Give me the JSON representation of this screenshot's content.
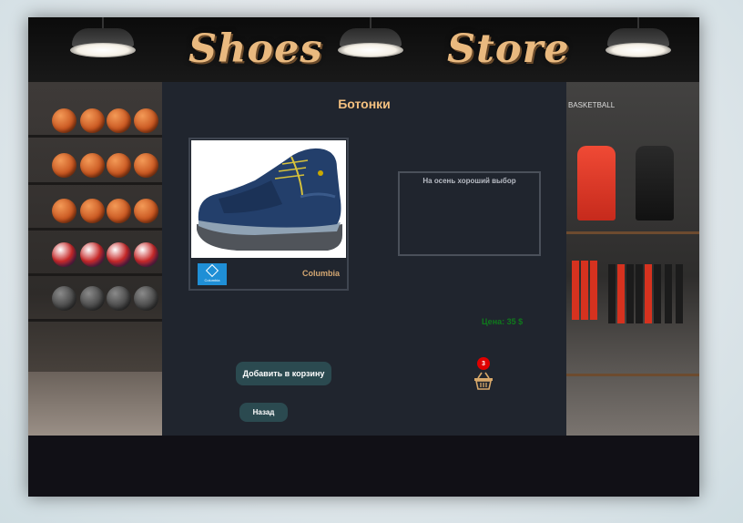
{
  "header": {
    "logo_word_1": "Shoes",
    "logo_word_2": "Store"
  },
  "left_display": {
    "sign": ""
  },
  "right_display": {
    "sign": "BASKETBALL"
  },
  "product": {
    "title": "Ботонки",
    "brand": "Columbia",
    "brand_logo_text": "Columbia",
    "description": "На осень хороший выбор",
    "price": "Цена: 35 $"
  },
  "actions": {
    "add_to_cart_label": "Добавить в корзину",
    "back_label": "Назад"
  },
  "cart": {
    "count": "3"
  },
  "icons": {
    "cart": "basket-icon",
    "brand": "columbia-logo"
  },
  "colors": {
    "panel_bg": "#20252e",
    "title": "#f4c07f",
    "price": "#0f7a1c",
    "button_bg": "#2b4a50",
    "badge": "#e00000",
    "brand_blue": "#1f8fd6"
  }
}
